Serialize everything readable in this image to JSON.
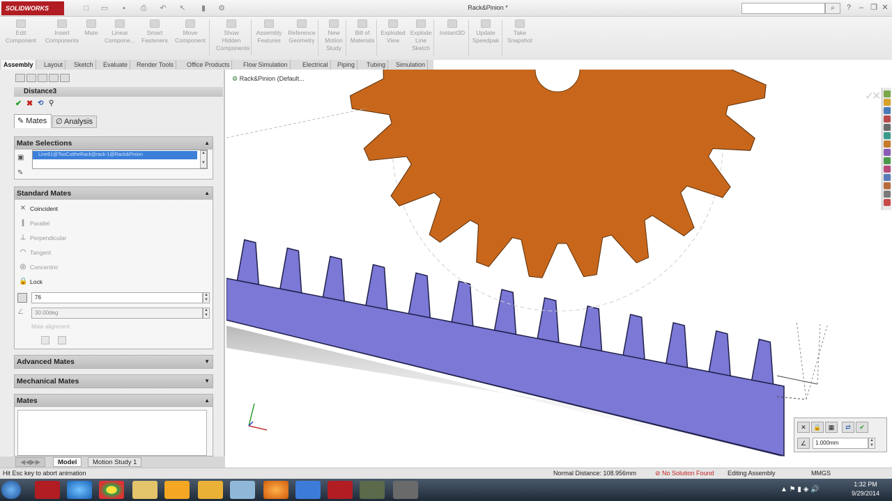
{
  "title": {
    "logo": "SOLIDWORKS",
    "document": "Rack&Pinion *",
    "search_placeholder": ""
  },
  "ribbon": [
    {
      "label": "Edit Component",
      "icon": "edit-component-icon"
    },
    {
      "label": "Insert Components",
      "icon": "insert-components-icon"
    },
    {
      "label": "Mate",
      "icon": "mate-icon"
    },
    {
      "label": "Linear Compone...",
      "icon": "linear-pattern-icon"
    },
    {
      "label": "Smart Fasteners",
      "icon": "smart-fasteners-icon"
    },
    {
      "label": "Move Component",
      "icon": "move-component-icon"
    },
    {
      "label": "Show Hidden Components",
      "icon": "show-hidden-icon"
    },
    {
      "label": "Assembly Features",
      "icon": "assembly-features-icon"
    },
    {
      "label": "Reference Geometry",
      "icon": "reference-geometry-icon"
    },
    {
      "label": "New Motion Study",
      "icon": "new-motion-study-icon"
    },
    {
      "label": "Bill of Materials",
      "icon": "bom-icon"
    },
    {
      "label": "Exploded View",
      "icon": "exploded-view-icon"
    },
    {
      "label": "Explode Line Sketch",
      "icon": "explode-line-sketch-icon"
    },
    {
      "label": "Instant3D",
      "icon": "instant3d-icon"
    },
    {
      "label": "Update Speedpak",
      "icon": "speedpak-icon"
    },
    {
      "label": "Take Snapshot",
      "icon": "snapshot-icon"
    }
  ],
  "tabs": [
    "Assembly",
    "Layout",
    "Sketch",
    "Evaluate",
    "Render Tools",
    "Office Products",
    "Flow Simulation",
    "Electrical",
    "Piping",
    "Tubing",
    "Simulation"
  ],
  "property_manager": {
    "title": "Distance3",
    "tab_mates": "Mates",
    "tab_analysis": "Analysis",
    "mate_selections": {
      "header": "Mate Selections",
      "value": "Line61@TooCuttheRack@rack-1@Rack&Pinion"
    },
    "standard_mates": {
      "header": "Standard Mates",
      "items": [
        {
          "label": "Coincident",
          "enabled": true
        },
        {
          "label": "Parallel",
          "enabled": false
        },
        {
          "label": "Perpendicular",
          "enabled": false
        },
        {
          "label": "Tangent",
          "enabled": false
        },
        {
          "label": "Concentric",
          "enabled": false
        },
        {
          "label": "Lock",
          "enabled": true
        }
      ],
      "distance_value": "76",
      "angle_value": "30.00deg",
      "mate_alignment": "Mate alignment:"
    },
    "advanced_mates": "Advanced Mates",
    "mechanical_mates": "Mechanical Mates",
    "mates": "Mates"
  },
  "viewport": {
    "tree_label": "Rack&Pinion  (Default...",
    "popup_value": "1.000mm"
  },
  "bottom_tabs": [
    "Model",
    "Motion Study 1"
  ],
  "status": {
    "hint": "Hit Esc key to abort animation",
    "normal_distance": "Normal Distance: 108.956mm",
    "solution": "No Solution Found",
    "mode": "Editing Assembly",
    "units": "MMGS"
  },
  "clock": {
    "time": "1:32 PM",
    "date": "9/29/2014"
  },
  "colors": {
    "gear": "#c8671b",
    "rack": "#7b78d6",
    "selection": "#3b7fd9"
  }
}
